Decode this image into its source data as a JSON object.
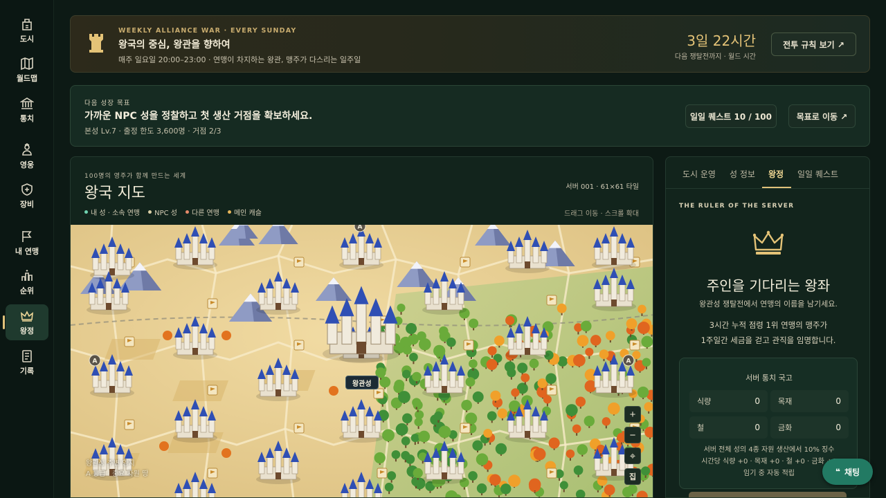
{
  "sidebar": {
    "items": [
      {
        "label": "도시",
        "icon": "city-icon"
      },
      {
        "label": "월드맵",
        "icon": "world-map-icon"
      },
      {
        "label": "통치",
        "icon": "govern-icon"
      },
      {
        "label": "영웅",
        "icon": "hero-icon"
      },
      {
        "label": "장비",
        "icon": "equipment-icon"
      },
      {
        "label": "내 연맹",
        "icon": "flag-icon"
      },
      {
        "label": "순위",
        "icon": "ranking-icon"
      },
      {
        "label": "왕정",
        "icon": "crown-icon"
      },
      {
        "label": "기록",
        "icon": "record-icon"
      }
    ],
    "active_index": 7
  },
  "war_banner": {
    "kicker": "WEEKLY ALLIANCE WAR · EVERY SUNDAY",
    "title": "왕국의 중심, 왕관을 향하여",
    "description": "매주 일요일 20:00–23:00 · 연맹이 차지하는 왕관, 맹주가 다스리는 일주일",
    "countdown": "3일 22시간",
    "countdown_sub": "다음 쟁탈전까지 · 월드 시간",
    "button_label": "전투 규칙 보기 ↗"
  },
  "goal_banner": {
    "kicker": "다음 성장 목표",
    "title": "가까운 NPC 성을 정찰하고 첫 생산 거점을 확보하세요.",
    "meta": "본성 Lv.7 · 출정 한도 3,600명 · 거점 2/3",
    "quest_button": "일일 퀘스트 10 / 100",
    "go_button": "목표로 이동 ↗"
  },
  "map": {
    "kicker": "100명의 영주가 함께 만드는 세계",
    "title": "왕국 지도",
    "server_info": "서버 001 · 61×61 타일",
    "legend": [
      {
        "label": "내 성 · 소속 연맹",
        "color": "#6fd3b0"
      },
      {
        "label": "NPC 성",
        "color": "#d9cfa6"
      },
      {
        "label": "다른 연맹",
        "color": "#e58a6a"
      },
      {
        "label": "메인 캐슬",
        "color": "#e6b65a"
      }
    ],
    "hint": "드래그 이동 · 스크롤 확대",
    "palace_label": "왕관성",
    "zoom_in": "+",
    "zoom_out": "−",
    "zoom_center": "⌖",
    "zoom_home": "집",
    "note_line1": "왕관성 주변 영지",
    "note_line2": "A 등급 · 중요 자원 땅",
    "colors": {
      "plain": "#e8cf93",
      "grass": "#a9c27a",
      "forest_green": "#4e9a3c",
      "forest_orange": "#e07a25"
    }
  },
  "right_panel": {
    "tabs": [
      "도시 운영",
      "성 정보",
      "왕정",
      "일일 퀘스트"
    ],
    "active_tab": 2,
    "kicker": "THE RULER OF THE SERVER",
    "throne_title": "주인을 기다리는 왕좌",
    "throne_sub": "왕관성 쟁탈전에서 연맹의 이름을 남기세요.",
    "throne_desc_1": "3시간 누적 점령 1위 연맹의 맹주가",
    "throne_desc_2": "1주일간 세금을 걷고 관직을 임명합니다.",
    "treasury": {
      "title": "서버 통치 국고",
      "resources": [
        {
          "label": "식량",
          "value": "0"
        },
        {
          "label": "목재",
          "value": "0"
        },
        {
          "label": "철",
          "value": "0"
        },
        {
          "label": "금화",
          "value": "0"
        }
      ],
      "note_1": "서버 전체 성의 4종 자원 생산에서 10% 징수",
      "note_2": "시간당 식량 +0 · 목재 +0 · 철 +0 · 금화 +0",
      "note_3": "임기 중 자동 적립"
    }
  },
  "chat": {
    "label": "채팅",
    "icon": "quote-icon"
  }
}
